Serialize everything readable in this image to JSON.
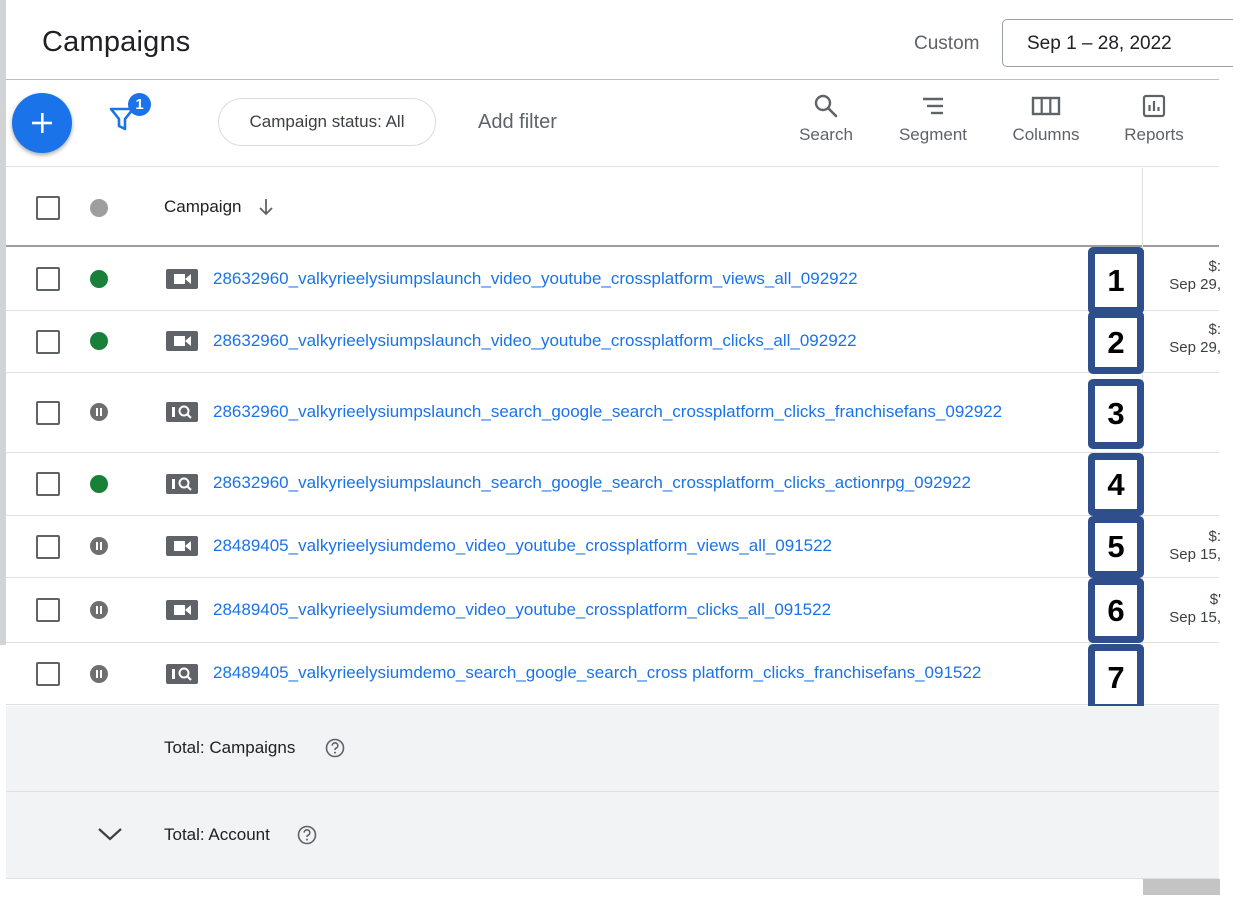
{
  "header": {
    "title": "Campaigns",
    "date_range_label": "Custom",
    "date_range_value": "Sep 1 – 28, 2022"
  },
  "toolbar": {
    "filter_badge_count": "1",
    "status_chip": "Campaign status: All",
    "add_filter": "Add filter",
    "search_label": "Search",
    "segment_label": "Segment",
    "columns_label": "Columns",
    "reports_label": "Reports"
  },
  "table": {
    "column_campaign": "Campaign",
    "rows": [
      {
        "status": "enabled",
        "type": "video",
        "name": "28632960_valkyrieelysiumpslaunch_video_youtube_crossplatform_views_all_092922",
        "marker": "1",
        "side_top": "$:",
        "side_bottom": "Sep 29,"
      },
      {
        "status": "enabled",
        "type": "video",
        "name": "28632960_valkyrieelysiumpslaunch_video_youtube_crossplatform_clicks_all_092922",
        "marker": "2",
        "side_top": "$:",
        "side_bottom": "Sep 29,"
      },
      {
        "status": "paused",
        "type": "search",
        "name": "28632960_valkyrieelysiumpslaunch_search_google_search_crossplatform_clicks_franchisefans_092922",
        "marker": "3",
        "side_top": "",
        "side_bottom": ""
      },
      {
        "status": "enabled",
        "type": "search",
        "name": "28632960_valkyrieelysiumpslaunch_search_google_search_crossplatform_clicks_actionrpg_092922",
        "marker": "4",
        "side_top": "",
        "side_bottom": ""
      },
      {
        "status": "paused",
        "type": "video",
        "name": "28489405_valkyrieelysiumdemo_video_youtube_crossplatform_views_all_091522",
        "marker": "5",
        "side_top": "$:",
        "side_bottom": "Sep 15,"
      },
      {
        "status": "paused",
        "type": "video",
        "name": "28489405_valkyrieelysiumdemo_video_youtube_crossplatform_clicks_all_091522",
        "marker": "6",
        "side_top": "$'",
        "side_bottom": "Sep 15,"
      },
      {
        "status": "paused",
        "type": "search",
        "name": "28489405_valkyrieelysiumdemo_search_google_search_cross platform_clicks_franchisefans_091522",
        "marker": "7",
        "side_top": "",
        "side_bottom": ""
      }
    ],
    "total_campaigns": "Total: Campaigns",
    "total_account": "Total: Account"
  },
  "colors": {
    "accent": "#1a73e8",
    "enabled": "#188038",
    "paused": "#6f6f6f",
    "marker_border": "#2f4e8c"
  }
}
